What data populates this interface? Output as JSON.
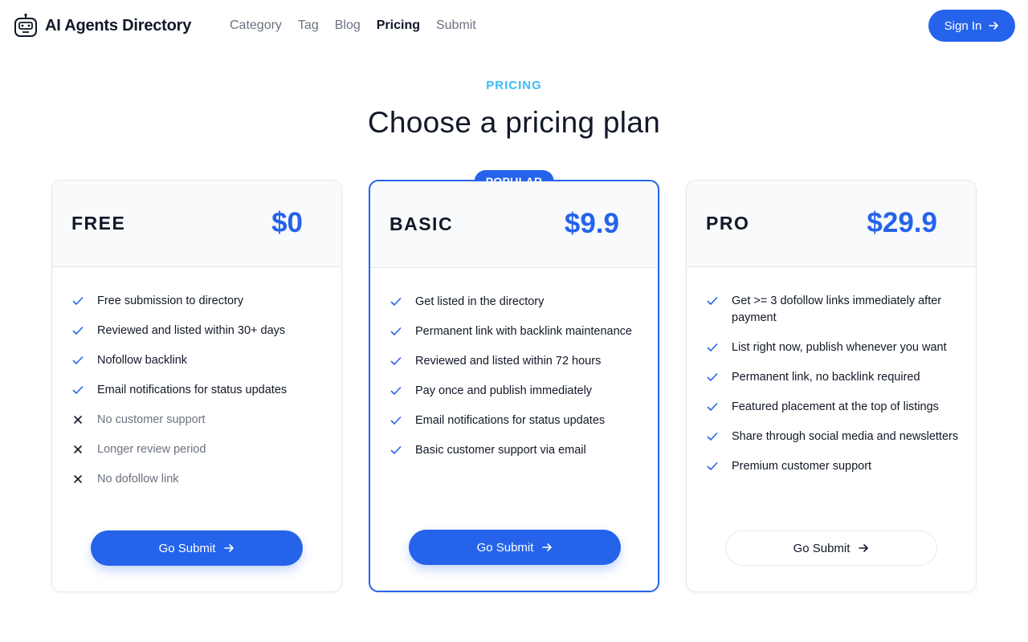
{
  "brand": {
    "name": "AI Agents Directory"
  },
  "nav": {
    "items": [
      "Category",
      "Tag",
      "Blog",
      "Pricing",
      "Submit"
    ],
    "active": "Pricing"
  },
  "header": {
    "signin_label": "Sign In"
  },
  "hero": {
    "eyebrow": "PRICING",
    "title": "Choose a pricing plan"
  },
  "colors": {
    "accent": "#2563eb",
    "eyebrow": "#38bdf8"
  },
  "plans": [
    {
      "name": "FREE",
      "price": "$0",
      "features": [
        {
          "text": "Free submission to directory",
          "included": true
        },
        {
          "text": "Reviewed and listed within 30+ days",
          "included": true
        },
        {
          "text": "Nofollow backlink",
          "included": true
        },
        {
          "text": "Email notifications for status updates",
          "included": true
        },
        {
          "text": "No customer support",
          "included": false
        },
        {
          "text": "Longer review period",
          "included": false
        },
        {
          "text": "No dofollow link",
          "included": false
        }
      ],
      "cta": "Go Submit"
    },
    {
      "name": "BASIC",
      "price": "$9.9",
      "badge": "POPULAR",
      "features": [
        {
          "text": "Get listed in the directory",
          "included": true
        },
        {
          "text": "Permanent link with backlink maintenance",
          "included": true
        },
        {
          "text": "Reviewed and listed within 72 hours",
          "included": true
        },
        {
          "text": "Pay once and publish immediately",
          "included": true
        },
        {
          "text": "Email notifications for status updates",
          "included": true
        },
        {
          "text": "Basic customer support via email",
          "included": true
        }
      ],
      "cta": "Go Submit"
    },
    {
      "name": "PRO",
      "price": "$29.9",
      "features": [
        {
          "text": "Get >= 3 dofollow links immediately after payment",
          "included": true
        },
        {
          "text": "List right now, publish whenever you want",
          "included": true
        },
        {
          "text": "Permanent link, no backlink required",
          "included": true
        },
        {
          "text": "Featured placement at the top of listings",
          "included": true
        },
        {
          "text": "Share through social media and newsletters",
          "included": true
        },
        {
          "text": "Premium customer support",
          "included": true
        }
      ],
      "cta": "Go Submit"
    }
  ]
}
